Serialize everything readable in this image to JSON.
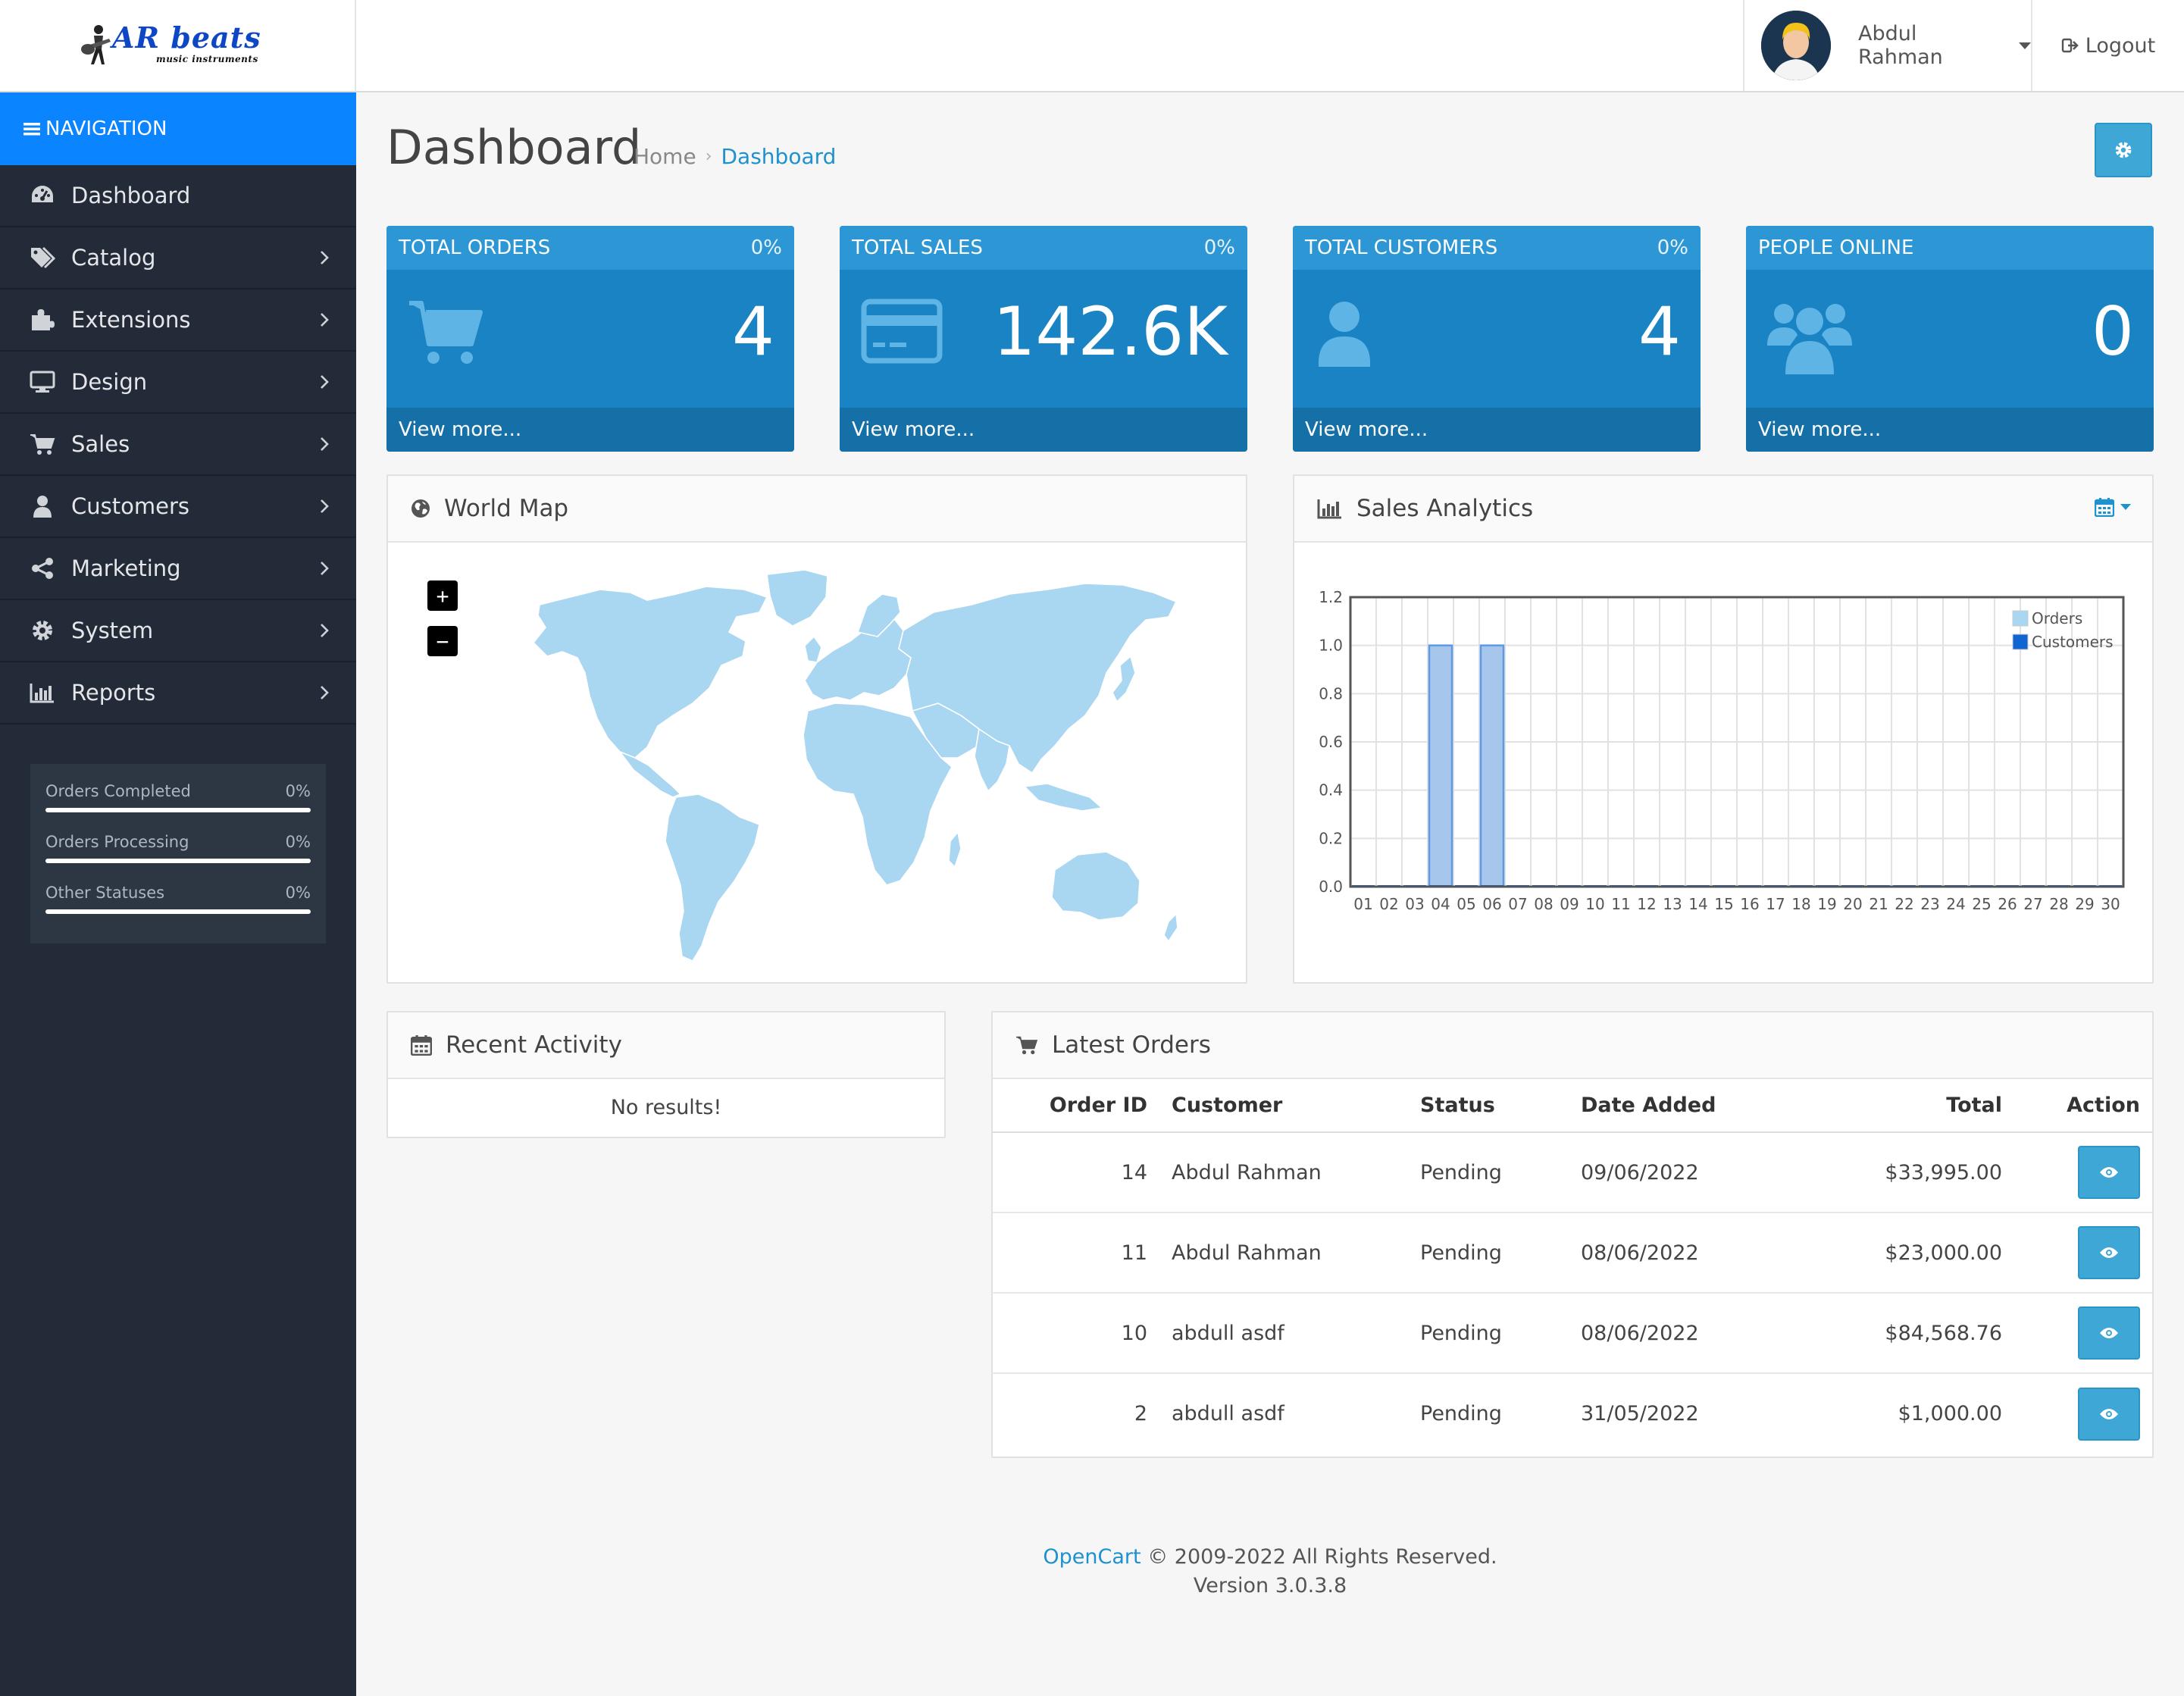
{
  "logo": {
    "brand": "AR beats",
    "tagline": "music instruments"
  },
  "header": {
    "user_name": "Abdul Rahman",
    "logout_label": "Logout"
  },
  "sidebar": {
    "nav_header": "NAVIGATION",
    "items": [
      {
        "label": "Dashboard",
        "icon": "dashboard-icon",
        "has_children": false
      },
      {
        "label": "Catalog",
        "icon": "tags-icon",
        "has_children": true
      },
      {
        "label": "Extensions",
        "icon": "puzzle-icon",
        "has_children": true
      },
      {
        "label": "Design",
        "icon": "desktop-icon",
        "has_children": true
      },
      {
        "label": "Sales",
        "icon": "cart-icon",
        "has_children": true
      },
      {
        "label": "Customers",
        "icon": "user-icon",
        "has_children": true
      },
      {
        "label": "Marketing",
        "icon": "share-icon",
        "has_children": true
      },
      {
        "label": "System",
        "icon": "cog-icon",
        "has_children": true
      },
      {
        "label": "Reports",
        "icon": "bar-chart-icon",
        "has_children": true
      }
    ],
    "stats": [
      {
        "label": "Orders Completed",
        "value": "0%"
      },
      {
        "label": "Orders Processing",
        "value": "0%"
      },
      {
        "label": "Other Statuses",
        "value": "0%"
      }
    ]
  },
  "page": {
    "title": "Dashboard",
    "breadcrumb": [
      "Home",
      "Dashboard"
    ]
  },
  "tiles": [
    {
      "title": "TOTAL ORDERS",
      "percent": "0%",
      "value": "4",
      "footer": "View more...",
      "icon": "shopping-cart-icon"
    },
    {
      "title": "TOTAL SALES",
      "percent": "0%",
      "value": "142.6K",
      "footer": "View more...",
      "icon": "credit-card-icon"
    },
    {
      "title": "TOTAL CUSTOMERS",
      "percent": "0%",
      "value": "4",
      "footer": "View more...",
      "icon": "user-icon"
    },
    {
      "title": "PEOPLE ONLINE",
      "percent": "",
      "value": "0",
      "footer": "View more...",
      "icon": "users-icon"
    }
  ],
  "world_map": {
    "title": "World Map",
    "zoom_in": "+",
    "zoom_out": "−"
  },
  "sales_analytics": {
    "title": "Sales Analytics"
  },
  "chart_data": {
    "type": "bar",
    "title": "",
    "xlabel": "",
    "ylabel": "",
    "categories": [
      "01",
      "02",
      "03",
      "04",
      "05",
      "06",
      "07",
      "08",
      "09",
      "10",
      "11",
      "12",
      "13",
      "14",
      "15",
      "16",
      "17",
      "18",
      "19",
      "20",
      "21",
      "22",
      "23",
      "24",
      "25",
      "26",
      "27",
      "28",
      "29",
      "30"
    ],
    "series": [
      {
        "name": "Orders",
        "color": "#9bc2e6",
        "values": [
          0,
          0,
          0,
          1,
          0,
          1,
          0,
          0,
          0,
          0,
          0,
          0,
          0,
          0,
          0,
          0,
          0,
          0,
          0,
          0,
          0,
          0,
          0,
          0,
          0,
          0,
          0,
          0,
          0,
          0
        ]
      },
      {
        "name": "Customers",
        "color": "#1065d2",
        "values": [
          0,
          0,
          0,
          0,
          0,
          0,
          0,
          0,
          0,
          0,
          0,
          0,
          0,
          0,
          0,
          0,
          0,
          0,
          0,
          0,
          0,
          0,
          0,
          0,
          0,
          0,
          0,
          0,
          0,
          0
        ]
      }
    ],
    "yticks": [
      "0.0",
      "0.2",
      "0.4",
      "0.6",
      "0.8",
      "1.0",
      "1.2"
    ],
    "ylim": [
      0,
      1.2
    ],
    "grid": true,
    "legend_position": "top-right"
  },
  "recent_activity": {
    "title": "Recent Activity",
    "empty": "No results!"
  },
  "latest_orders": {
    "title": "Latest Orders",
    "columns": [
      "Order ID",
      "Customer",
      "Status",
      "Date Added",
      "Total",
      "Action"
    ],
    "rows": [
      {
        "id": "14",
        "customer": "Abdul Rahman",
        "status": "Pending",
        "date": "09/06/2022",
        "total": "$33,995.00"
      },
      {
        "id": "11",
        "customer": "Abdul Rahman",
        "status": "Pending",
        "date": "08/06/2022",
        "total": "$23,000.00"
      },
      {
        "id": "10",
        "customer": "abdull asdf",
        "status": "Pending",
        "date": "08/06/2022",
        "total": "$84,568.76"
      },
      {
        "id": "2",
        "customer": "abdull asdf",
        "status": "Pending",
        "date": "31/05/2022",
        "total": "$1,000.00"
      }
    ]
  },
  "footer": {
    "link": "OpenCart",
    "copyright": " © 2009-2022 All Rights Reserved.",
    "version": "Version 3.0.3.8"
  }
}
